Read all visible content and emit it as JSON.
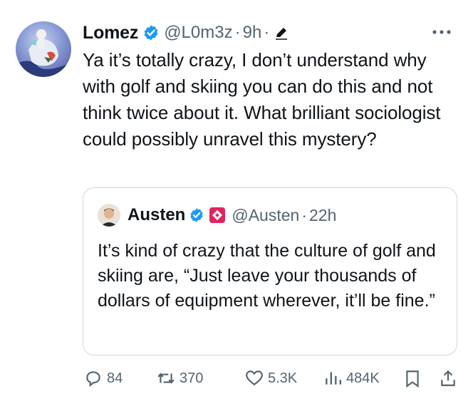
{
  "tweet": {
    "author_name": "Lomez",
    "handle": "@L0m3z",
    "separator": "·",
    "time": "9h",
    "text": "Ya it’s totally crazy, I don’t understand why with golf and skiing you can do this and not think twice about it. What brilliant sociologist could possibly unravel this mystery?"
  },
  "quote": {
    "author_name": "Austen",
    "handle": "@Austen",
    "separator": "·",
    "time": "22h",
    "text": "It’s kind of crazy that the culture of golf and skiing are, “Just leave your thousands of dollars of equipment wherever, it’ll be fine.”"
  },
  "actions": {
    "replies": "84",
    "reposts": "370",
    "likes": "5.3K",
    "views": "484K"
  },
  "colors": {
    "verified_blue": "#1d9bf0",
    "secondary_text": "#536471",
    "quote_border": "#cfd9de",
    "quote_badge_red": "#e0245e"
  },
  "icons": [
    "verified-icon",
    "pencil-icon",
    "more-icon",
    "reply-icon",
    "repost-icon",
    "like-icon",
    "views-icon",
    "bookmark-icon",
    "share-icon"
  ]
}
